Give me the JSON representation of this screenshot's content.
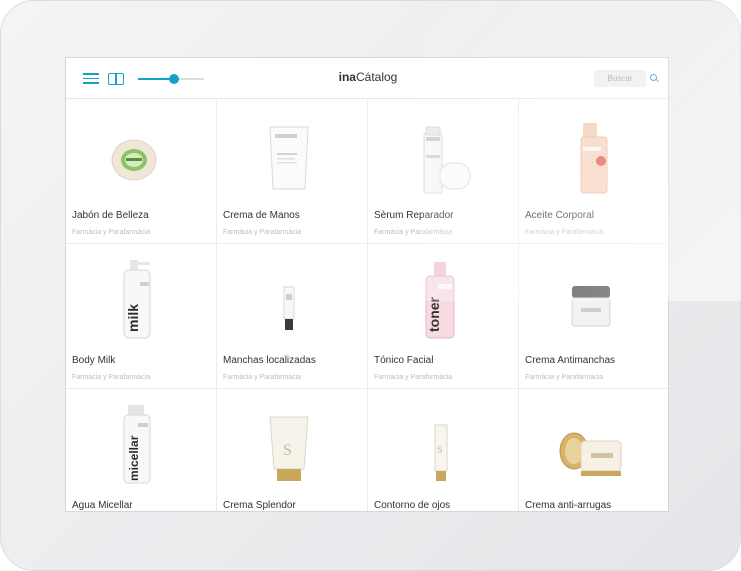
{
  "header": {
    "title_bold": "ina",
    "title_rest": "Cátalog",
    "search_placeholder": "Buscar",
    "zoom_level": 0.55
  },
  "colors": {
    "accent": "#1aa0c8"
  },
  "icons": {
    "menu": "menu-icon",
    "book": "book-icon",
    "search": "search-icon"
  },
  "products": [
    {
      "name": "Jabón de Belleza",
      "category": "Farmàcia y Parafarmàcia"
    },
    {
      "name": "Crema de Manos",
      "category": "Farmàcia y Parafarmàcia"
    },
    {
      "name": "Sèrum Reparador",
      "category": "Farmàcia y Parafarmàcia"
    },
    {
      "name": "Aceite Corporal",
      "category": "Farmàcia y Parafarmàcia"
    },
    {
      "name": "Body Milk",
      "category": "Farmàcia y Parafarmàcia"
    },
    {
      "name": "Manchas localizadas",
      "category": "Farmàcia y Parafarmàcia"
    },
    {
      "name": "Tónico Facial",
      "category": "Farmàcia y Parafarmàcia"
    },
    {
      "name": "Crema Antimanchas",
      "category": "Farmàcia y Parafarmàcia"
    },
    {
      "name": "Agua Micellar",
      "category": ""
    },
    {
      "name": "Crema Splendor",
      "category": ""
    },
    {
      "name": "Contorno de ojos",
      "category": ""
    },
    {
      "name": "Crema anti-arrugas",
      "category": ""
    }
  ],
  "product_labels": {
    "body_milk": "milk",
    "toner": "toner",
    "micellar": "micellar"
  }
}
